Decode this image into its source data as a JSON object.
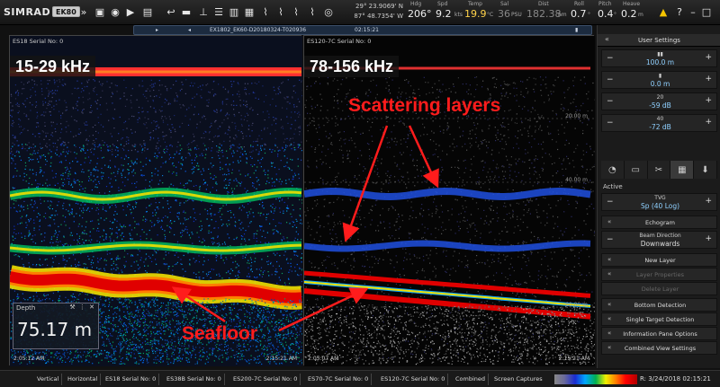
{
  "toolbar": {
    "brand": "SIMRAD",
    "model": "EK80",
    "latitude": "29° 23.9069' N",
    "longitude": "87° 48.7354' W",
    "time_top": "",
    "readouts": [
      {
        "label": "Hdg",
        "value": "206°",
        "unit": ""
      },
      {
        "label": "Spd",
        "value": "9.2",
        "unit": "kts"
      },
      {
        "label": "Temp",
        "value": "19.9",
        "unit": "°C"
      },
      {
        "label": "Sal",
        "value": "36",
        "unit": "PSU"
      },
      {
        "label": "Dist",
        "value": "182.38",
        "unit": "nm"
      },
      {
        "label": "Roll",
        "value": "0.7",
        "unit": "°"
      },
      {
        "label": "Pitch",
        "value": "0.4",
        "unit": "°"
      },
      {
        "label": "Heave",
        "value": "0.2",
        "unit": "m"
      }
    ]
  },
  "filebar": {
    "filename": "EX1802_EK60-D20180324-T020936",
    "time": "02:15:21"
  },
  "panes": {
    "left": {
      "title": "ES18 Serial No: 0",
      "freq": "15-29 kHz",
      "depth_tick": "",
      "time_start": "2:05:12 AM",
      "time_end": "2:15:21 AM"
    },
    "right": {
      "title": "ES120-7C Serial No: 0",
      "freq": "78-156 kHz",
      "depth_tick_1": "20.00 m",
      "depth_tick_2": "40.00 m",
      "depth_tick_3": "60.00 m",
      "time_start": "2:05:07 AM",
      "time_end": "2:15:21 AM"
    }
  },
  "depth": {
    "label": "Depth",
    "value": "75.17 m"
  },
  "annotations": {
    "scattering": "Scattering layers",
    "seafloor": "Seafloor"
  },
  "side": {
    "user_settings": "User Settings",
    "controls": [
      {
        "value": "100.0 m"
      },
      {
        "value": "0.0 m"
      },
      {
        "value": "-59 dB",
        "sub": "20"
      },
      {
        "value": "-72 dB",
        "sub": "40"
      }
    ],
    "active": "Active",
    "tvg_label": "TVG",
    "tvg_value": "Sp (40 Log)",
    "buttons": [
      "Echogram",
      "Beam Direction",
      "New Layer",
      "Layer Properties",
      "Delete Layer",
      "Bottom Detection",
      "Single Target Detection",
      "Information Pane Options",
      "Combined View Settings"
    ],
    "beam_direction_value": "Downwards"
  },
  "bottom": {
    "tabs": [
      "Vertical",
      "Horizontal",
      "ES18 Serial No: 0",
      "ES38B Serial No: 0",
      "ES200-7C Serial No: 0",
      "ES70-7C Serial No: 0",
      "ES120-7C Serial No: 0",
      "Combined",
      "Screen Captures"
    ],
    "datetime": "R: 3/24/2018 02:15:21"
  },
  "colors": {
    "annotation": "#ff1c1c",
    "accent_value": "#8fd0ff"
  }
}
